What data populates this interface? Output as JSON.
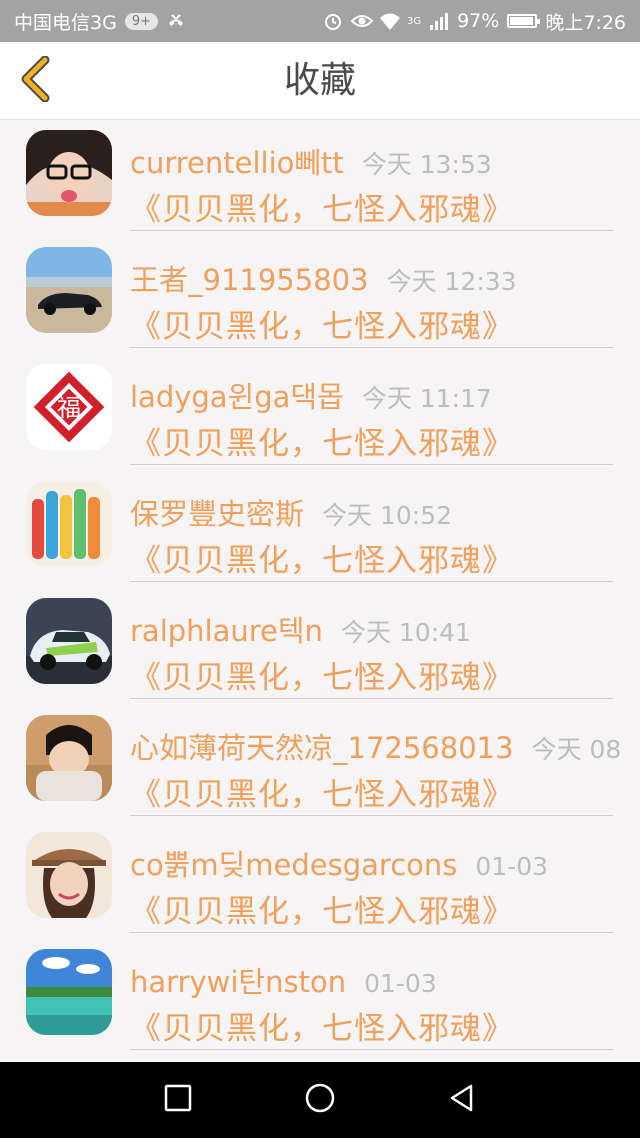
{
  "status_bar": {
    "carrier": "中国电信3G",
    "badge": "9+",
    "network": "3G",
    "battery": "97%",
    "battery_level": 0.97,
    "time": "晚上7:26"
  },
  "header": {
    "title": "收藏",
    "back_icon": "chevron-left-icon",
    "accent_color": "#f0b020"
  },
  "items": [
    {
      "name": "currentellio뻬tt",
      "time": "今天 13:53",
      "work": "《贝贝黑化，七怪入邪魂》"
    },
    {
      "name": "王者_911955803",
      "time": "今天 12:33",
      "work": "《贝贝黑化，七怪入邪魂》"
    },
    {
      "name": "ladyga윈ga댁몹",
      "time": "今天 11:17",
      "work": "《贝贝黑化，七怪入邪魂》"
    },
    {
      "name": "保罗豐史密斯",
      "time": "今天 10:52",
      "work": "《贝贝黑化，七怪入邪魂》"
    },
    {
      "name": "ralphlaure텍n",
      "time": "今天 10:41",
      "work": "《贝贝黑化，七怪入邪魂》"
    },
    {
      "name": "心如薄荷天然凉_172568013",
      "time": "今天 08",
      "work": "《贝贝黑化，七怪入邪魂》"
    },
    {
      "name": "co뿕m딪medesgarcons",
      "time": "01-03",
      "work": "《贝贝黑化，七怪入邪魂》"
    },
    {
      "name": "harrywi탄nston",
      "time": "01-03",
      "work": "《贝贝黑化，七怪入邪魂》"
    }
  ],
  "navbar": {
    "recent_icon": "square-icon",
    "home_icon": "circle-icon",
    "back_icon": "triangle-back-icon"
  },
  "colors": {
    "name": "#f0a05a",
    "time": "#bdbdbd",
    "background": "#f7f4f6"
  }
}
